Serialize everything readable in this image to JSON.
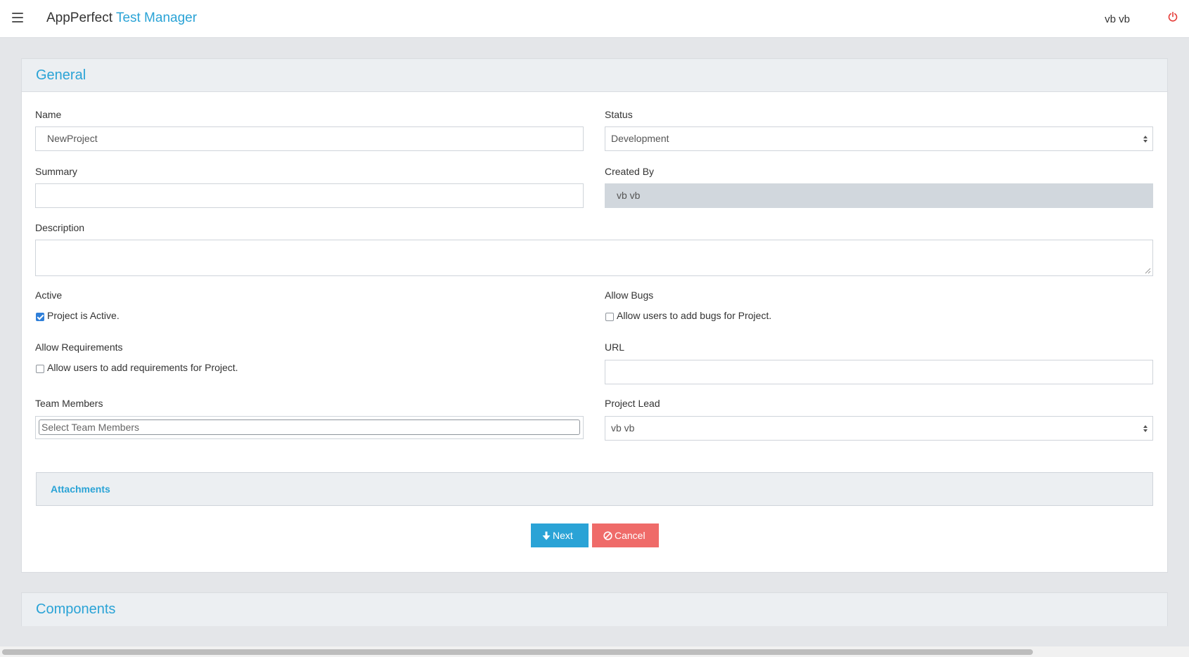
{
  "header": {
    "brand_main": "AppPerfect",
    "brand_accent": "Test Manager",
    "user": "vb vb",
    "menu_icon": "hamburger-menu-icon",
    "logout_icon": "power-icon"
  },
  "general": {
    "title": "General",
    "fields": {
      "name": {
        "label": "Name",
        "value": "NewProject"
      },
      "status": {
        "label": "Status",
        "value": "Development"
      },
      "summary": {
        "label": "Summary",
        "value": ""
      },
      "created_by": {
        "label": "Created By",
        "value": "vb vb"
      },
      "description": {
        "label": "Description",
        "value": ""
      },
      "active": {
        "label": "Active",
        "checkbox_label": "Project is Active.",
        "checked": true
      },
      "allow_bugs": {
        "label": "Allow Bugs",
        "checkbox_label": "Allow users to add bugs for Project.",
        "checked": false
      },
      "allow_requirements": {
        "label": "Allow Requirements",
        "checkbox_label": "Allow users to add requirements for Project.",
        "checked": false
      },
      "url": {
        "label": "URL",
        "value": ""
      },
      "team_members": {
        "label": "Team Members",
        "placeholder": "Select Team Members"
      },
      "project_lead": {
        "label": "Project Lead",
        "value": "vb vb"
      }
    },
    "attachments_label": "Attachments",
    "buttons": {
      "next": "Next",
      "cancel": "Cancel"
    }
  },
  "components": {
    "title": "Components"
  },
  "colors": {
    "accent": "#2aa3d6",
    "cancel": "#ef6b69",
    "checkbox": "#2f7fd9",
    "logout": "#e53935"
  }
}
